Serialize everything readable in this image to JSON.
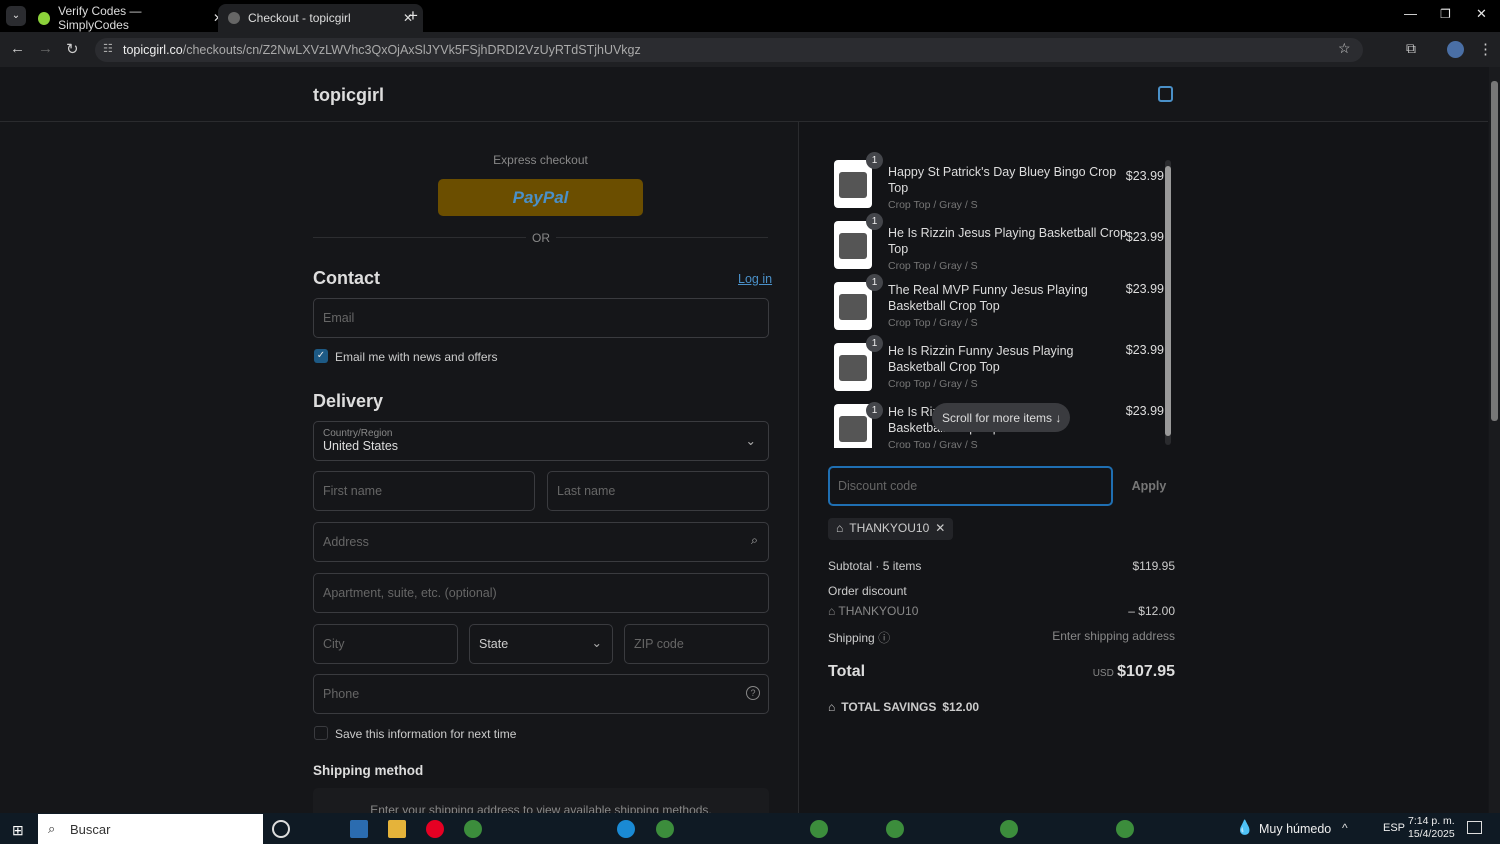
{
  "browser": {
    "tabs": [
      {
        "title": "Verify Codes — SimplyCodes"
      },
      {
        "title": "Checkout - topicgirl"
      }
    ],
    "url_host": "topicgirl.co",
    "url_path": "/checkouts/cn/Z2NwLXVzLWVhc3QxOjAxSlJYVk5FSjhDRDI2VzUyRTdSTjhUVkgz"
  },
  "header": {
    "store_name": "topicgirl"
  },
  "express": {
    "label": "Express checkout",
    "paypal": "PayPal",
    "or": "OR"
  },
  "contact": {
    "title": "Contact",
    "login": "Log in",
    "email_placeholder": "Email",
    "newsletter": "Email me with news and offers",
    "newsletter_checked": true
  },
  "delivery": {
    "title": "Delivery",
    "country_label": "Country/Region",
    "country": "United States",
    "first_name": "First name",
    "last_name": "Last name",
    "address": "Address",
    "apartment": "Apartment, suite, etc. (optional)",
    "city": "City",
    "state": "State",
    "zip": "ZIP code",
    "phone": "Phone",
    "save_info": "Save this information for next time"
  },
  "shipping": {
    "title": "Shipping method",
    "message": "Enter your shipping address to view available shipping methods."
  },
  "cart": {
    "items": [
      {
        "qty": "1",
        "name": "Happy St Patrick's Day Bluey Bingo Crop Top",
        "variant": "Crop Top / Gray / S",
        "price": "$23.99"
      },
      {
        "qty": "1",
        "name": "He Is Rizzin Jesus Playing Basketball Crop Top",
        "variant": "Crop Top / Gray / S",
        "price": "$23.99"
      },
      {
        "qty": "1",
        "name": "The Real MVP Funny Jesus Playing Basketball Crop Top",
        "variant": "Crop Top / Gray / S",
        "price": "$23.99"
      },
      {
        "qty": "1",
        "name": "He Is Rizzin Funny Jesus Playing Basketball Crop Top",
        "variant": "Crop Top / Gray / S",
        "price": "$23.99"
      },
      {
        "qty": "1",
        "name": "He Is Rizzin Jesus Playing Basketball Crop Top",
        "variant": "Crop Top / Gray / S",
        "price": "$23.99"
      }
    ],
    "scroll_hint": "Scroll for more items"
  },
  "discount": {
    "placeholder": "Discount code",
    "apply": "Apply",
    "applied_code": "THANKYOU10"
  },
  "summary": {
    "subtotal_label": "Subtotal · 5 items",
    "subtotal": "$119.95",
    "order_discount": "Order discount",
    "discount_code": "THANKYOU10",
    "discount_amount": "– $12.00",
    "shipping_label": "Shipping",
    "shipping_value": "Enter shipping address",
    "total_label": "Total",
    "currency": "USD",
    "total": "$107.95",
    "savings_label": "TOTAL SAVINGS",
    "savings": "$12.00"
  },
  "taskbar": {
    "search": "Buscar",
    "weather": "Muy húmedo",
    "lang": "ESP",
    "time": "7:14 p. m.",
    "date": "15/4/2025"
  },
  "colors": {
    "paypal_bg": "#6b4e00",
    "accent": "#4a90c8"
  }
}
